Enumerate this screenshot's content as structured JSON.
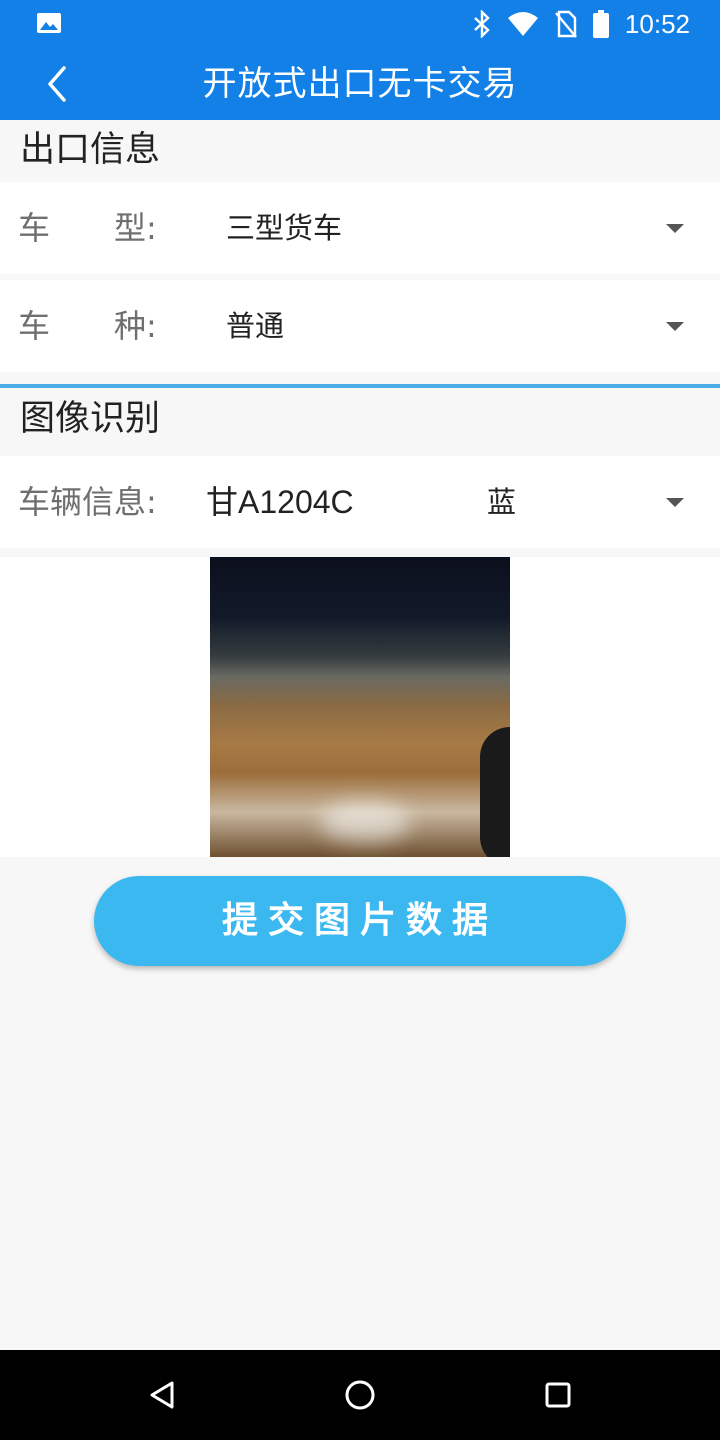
{
  "status_bar": {
    "time": "10:52",
    "icons": [
      "image-icon",
      "bluetooth-icon",
      "wifi-icon",
      "no-sim-icon",
      "battery-icon"
    ]
  },
  "app_bar": {
    "title": "开放式出口无卡交易",
    "back_icon": "chevron-left-icon"
  },
  "exit_info": {
    "section_title": "出口信息",
    "vehicle_type": {
      "label": "车　　型:",
      "value": "三型货车"
    },
    "vehicle_kind": {
      "label": "车　　种:",
      "value": "普通"
    }
  },
  "image_recognition": {
    "section_title": "图像识别",
    "vehicle_info": {
      "label": "车辆信息:",
      "plate": "甘A1204C",
      "color": "蓝"
    }
  },
  "submit": {
    "label": "提交图片数据"
  },
  "colors": {
    "primary": "#1380e8",
    "button": "#3bb8f0",
    "divider": "#4aaee8"
  }
}
